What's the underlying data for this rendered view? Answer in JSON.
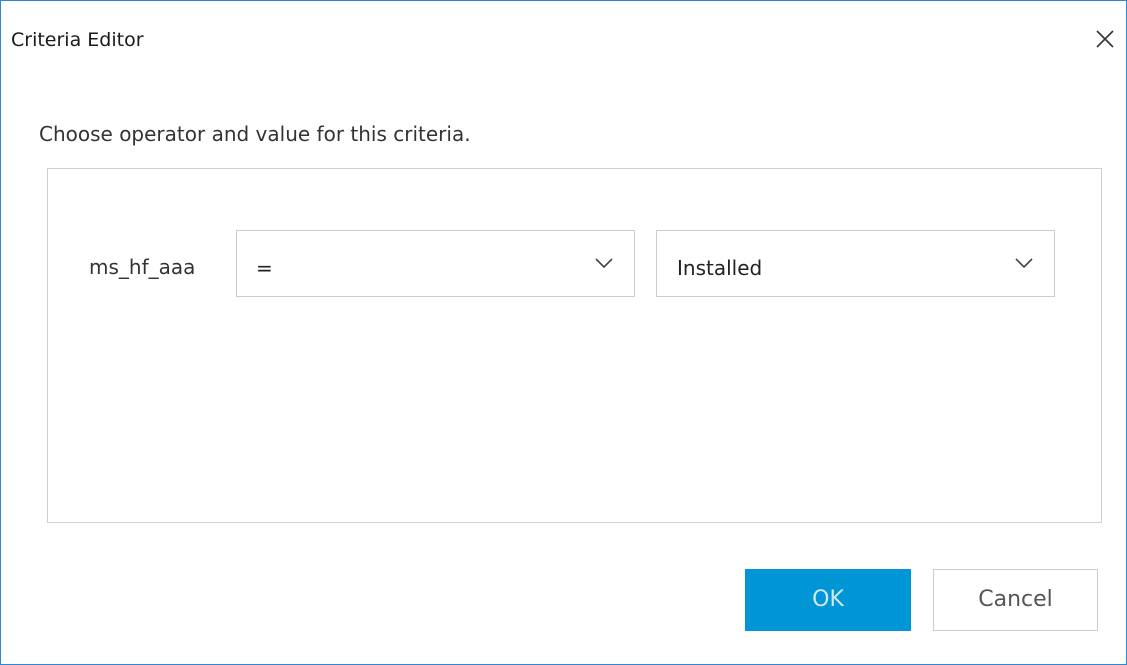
{
  "window": {
    "title": "Criteria Editor"
  },
  "dialog": {
    "instruction": "Choose operator and value for this criteria.",
    "criteria": {
      "field_label": "ms_hf_aaa",
      "operator_selected": "=",
      "value_selected": "Installed"
    }
  },
  "buttons": {
    "ok_label": "OK",
    "cancel_label": "Cancel"
  },
  "icons": {
    "close": "close-icon",
    "dropdown": "chevron-down-icon"
  },
  "colors": {
    "accent": "#0096d6",
    "window_border": "#2b88d8"
  }
}
